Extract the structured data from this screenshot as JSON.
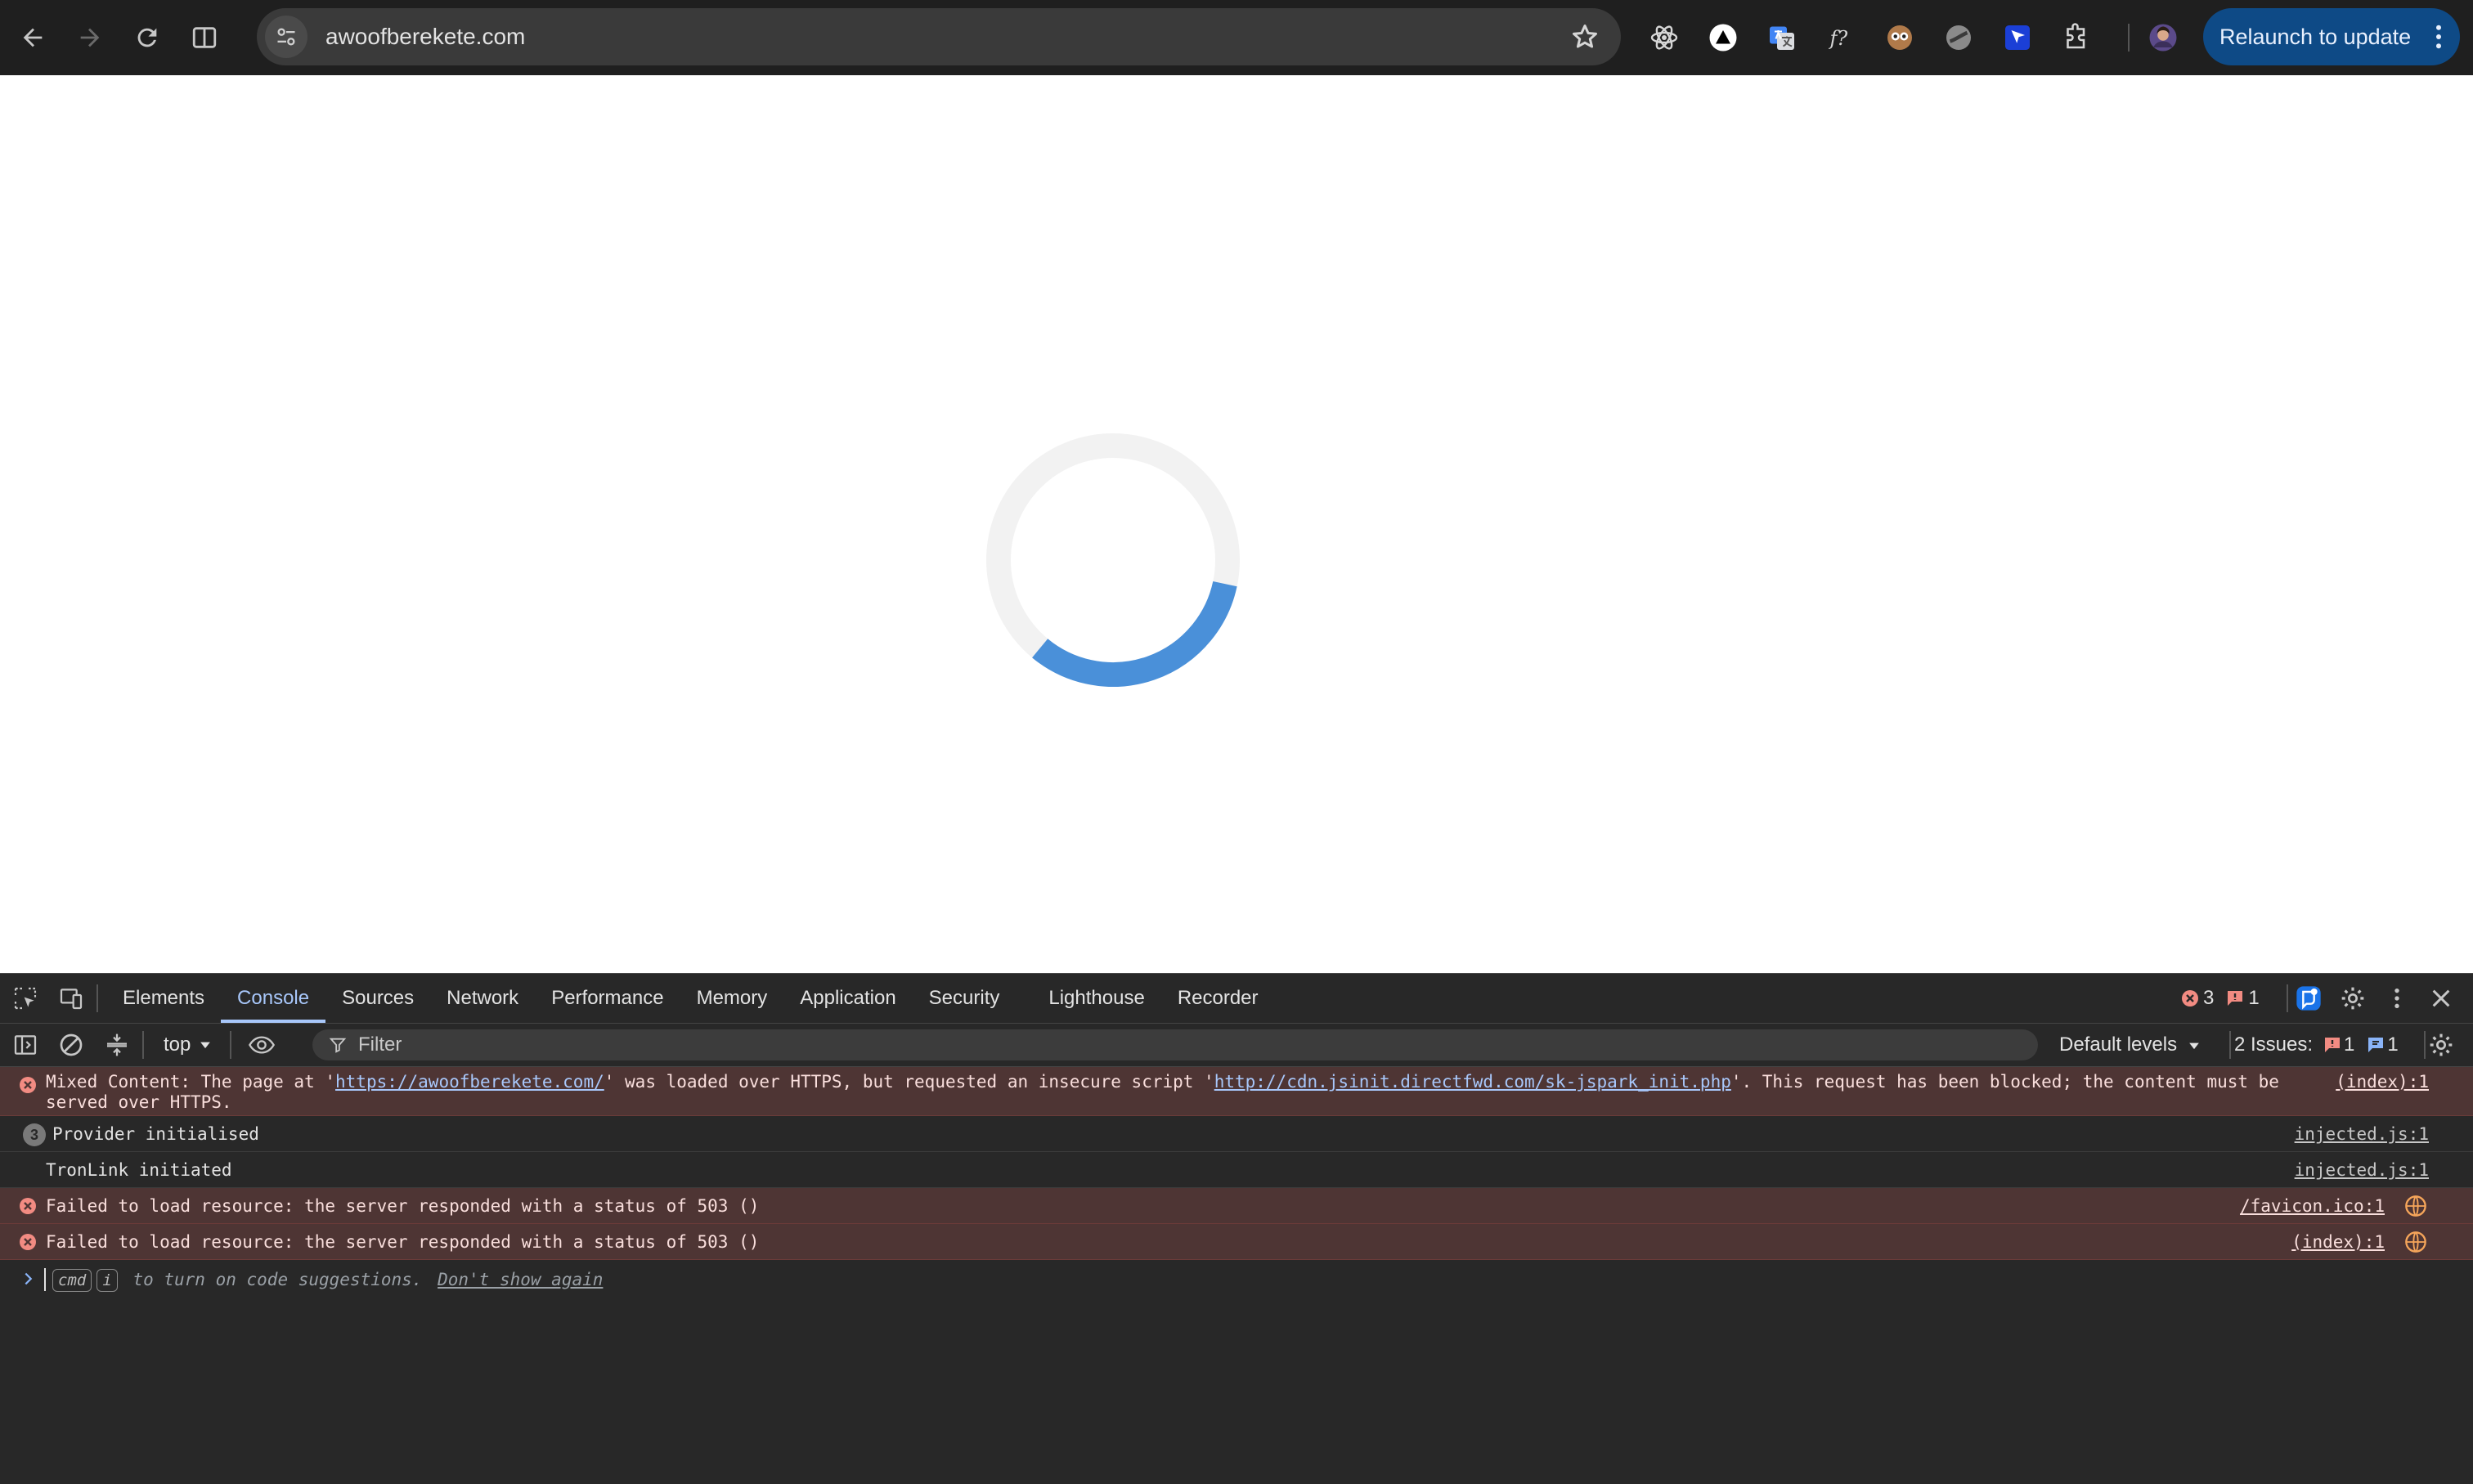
{
  "browser": {
    "url": "awoofberekete.com",
    "relaunch_label": "Relaunch to update"
  },
  "devtools": {
    "tabs": [
      {
        "label": "Elements"
      },
      {
        "label": "Console"
      },
      {
        "label": "Sources"
      },
      {
        "label": "Network"
      },
      {
        "label": "Performance"
      },
      {
        "label": "Memory"
      },
      {
        "label": "Application"
      },
      {
        "label": "Security"
      },
      {
        "label": "Lighthouse"
      },
      {
        "label": "Recorder"
      }
    ],
    "error_count": "3",
    "warning_count": "1",
    "context": "top",
    "filter_placeholder": "Filter",
    "levels_label": "Default levels",
    "issues_label": "2 Issues:",
    "issues_error_count": "1",
    "issues_info_count": "1"
  },
  "console": {
    "messages": [
      {
        "type": "error",
        "prefix": "Mixed Content: The page at '",
        "link1": "https://awoofberekete.com/",
        "middle": "' was loaded over HTTPS, but requested an insecure script '",
        "link2": "http://cdn.jsinit.directfwd.com/sk-jspark_init.php",
        "suffix": "'. This request has been blocked; the content must be served over HTTPS.",
        "source": "(index):1"
      },
      {
        "type": "info",
        "repeat": "3",
        "text": "Provider initialised",
        "source": "injected.js:1"
      },
      {
        "type": "info",
        "text": "TronLink initiated",
        "source": "injected.js:1"
      },
      {
        "type": "error",
        "text": "Failed to load resource: the server responded with a status of 503 ()",
        "source": "/favicon.ico:1"
      },
      {
        "type": "error",
        "text": "Failed to load resource: the server responded with a status of 503 ()",
        "source": "(index):1"
      }
    ],
    "prompt": {
      "key1": "cmd",
      "key2": "i",
      "hint": "to turn on code suggestions.",
      "dismiss": "Don't show again"
    }
  },
  "colors": {
    "spinner_accent": "#4a90d9",
    "spinner_track": "#f2f2f2",
    "error_bg": "#4e3534",
    "active_tab": "#a8c7fa"
  }
}
